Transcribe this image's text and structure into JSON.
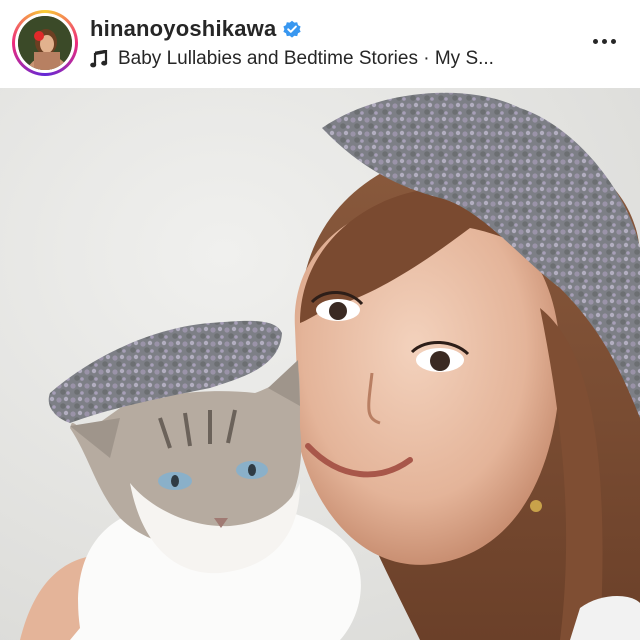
{
  "post": {
    "username": "hinanoyoshikawa",
    "verified": true,
    "music": "Baby Lullabies and Bedtime Stories · My S...",
    "icons": {
      "verified": "verified-badge-icon",
      "music": "music-note-icon",
      "more": "more-options-icon"
    },
    "colors": {
      "text": "#262626",
      "verified": "#3897f0",
      "story_ring": [
        "#f9ce34",
        "#ee2a7b",
        "#6228d7"
      ]
    }
  }
}
